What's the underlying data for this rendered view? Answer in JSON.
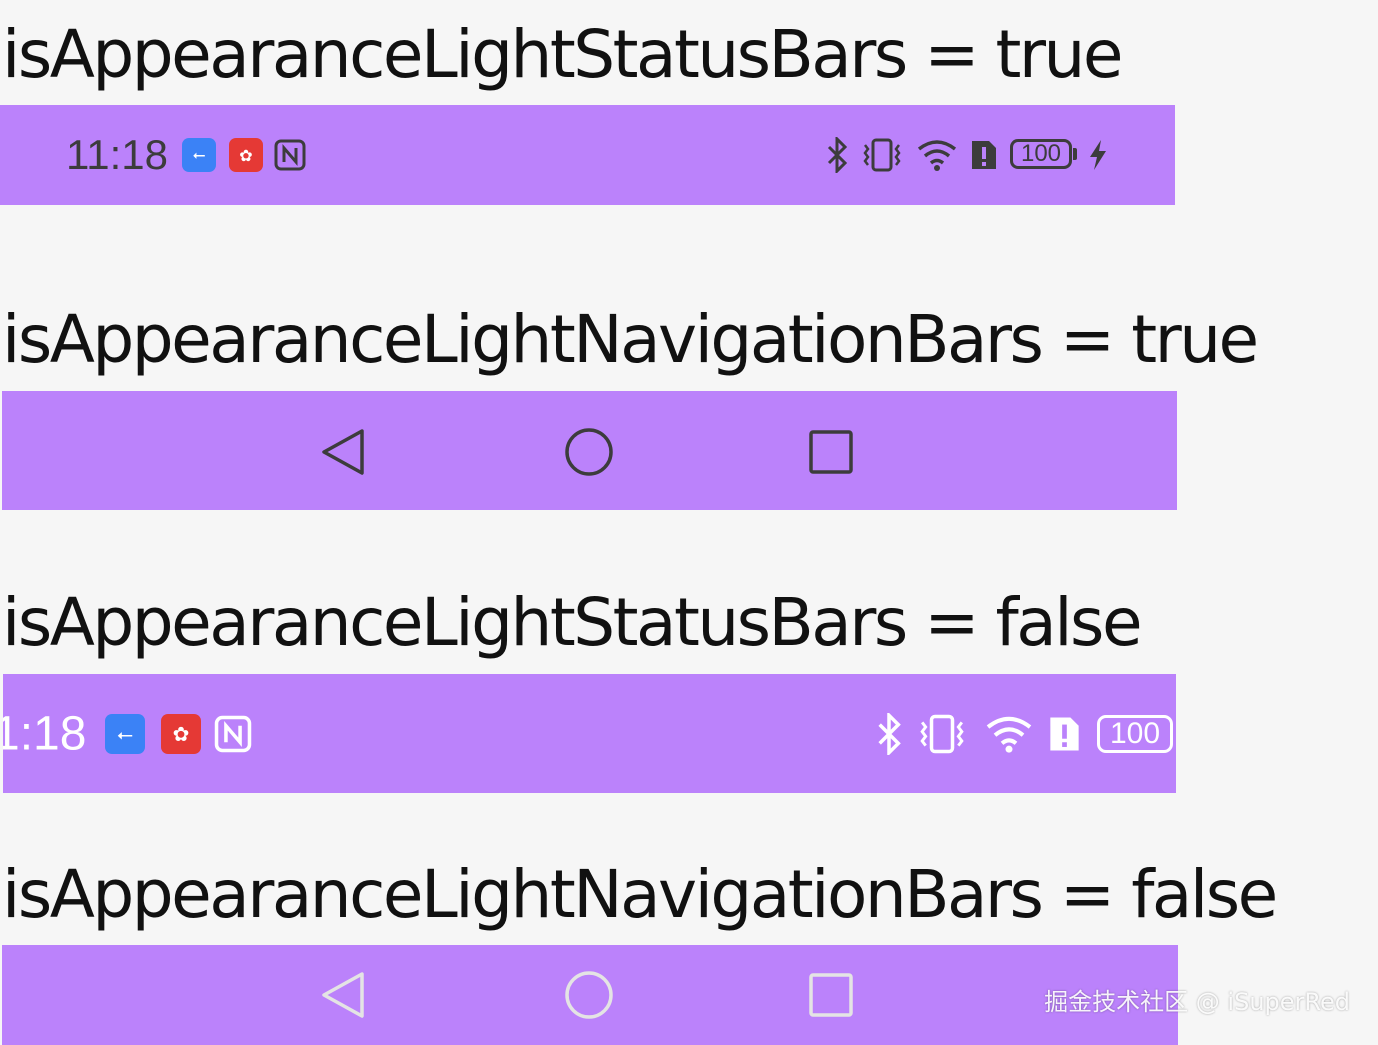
{
  "colors": {
    "page_background": "#f6f6f6",
    "bar_background": "#bb82fb",
    "dark_icon": "#3c3c3c",
    "light_icon": "#ffffff",
    "usb_badge": "#3b82f6",
    "huawei_badge": "#e53935"
  },
  "sections": [
    {
      "heading": "isAppearanceLightStatusBars = true",
      "status_bar": {
        "time": "11:18",
        "battery": "100",
        "icons": [
          "usb-debugging-icon",
          "huawei-app-icon",
          "nfc-icon",
          "bluetooth-icon",
          "vibrate-icon",
          "wifi-icon",
          "sim-alert-icon",
          "battery-icon",
          "charging-bolt-icon"
        ]
      }
    },
    {
      "heading": "isAppearanceLightNavigationBars = true",
      "nav_bar": {
        "icons": [
          "back-triangle-icon",
          "home-circle-icon",
          "recents-square-icon"
        ]
      }
    },
    {
      "heading": "isAppearanceLightStatusBars = false",
      "status_bar": {
        "time": "1:18",
        "battery": "100",
        "icons": [
          "usb-debugging-icon",
          "huawei-app-icon",
          "nfc-icon",
          "bluetooth-icon",
          "vibrate-icon",
          "wifi-icon",
          "sim-alert-icon",
          "battery-icon"
        ]
      }
    },
    {
      "heading": "isAppearanceLightNavigationBars = false",
      "nav_bar": {
        "icons": [
          "back-triangle-icon",
          "home-circle-icon",
          "recents-square-icon"
        ]
      }
    }
  ],
  "watermark": "掘金技术社区 @ iSuperRed"
}
